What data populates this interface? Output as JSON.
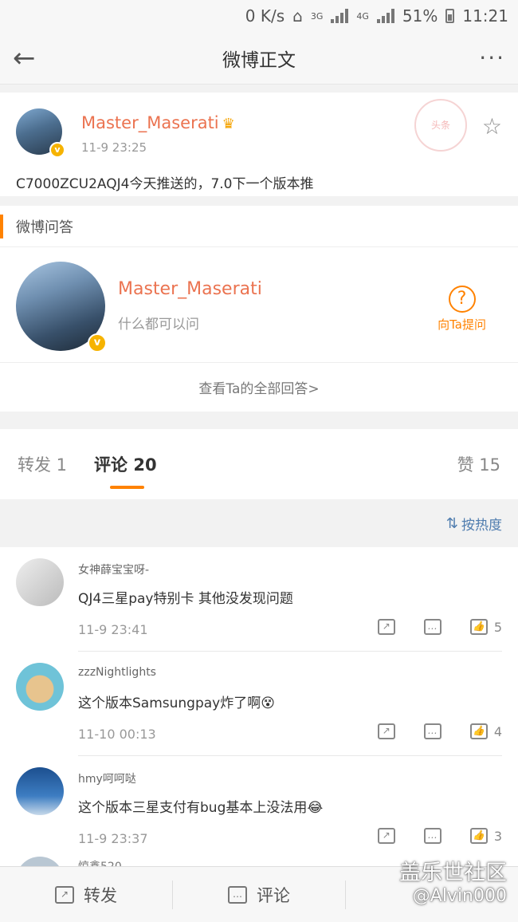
{
  "status_bar": {
    "speed": "0 K/s",
    "net1": "3G",
    "net2": "4G",
    "battery": "51%",
    "time": "11:21"
  },
  "nav": {
    "back_icon": "back-arrow-icon",
    "title": "微博正文",
    "more_icon": "more-dots-icon"
  },
  "post": {
    "author": "Master_Maserati",
    "time": "11-9 23:25",
    "text": "C7000ZCU2AQJ4今天推送的，7.0下一个版本推",
    "stamp": "头条"
  },
  "qa": {
    "header": "微博问答",
    "name": "Master_Maserati",
    "subtitle": "什么都可以问",
    "ask_label": "向Ta提问",
    "view_all": "查看Ta的全部回答>"
  },
  "tabs": {
    "repost": "转发 1",
    "comment": "评论 20",
    "like": "赞 15"
  },
  "sort": {
    "label": "按热度"
  },
  "comments": [
    {
      "name": "女神薛宝宝呀-",
      "text": "QJ4三星pay特别卡 其他没发现问题",
      "time": "11-9 23:41",
      "likes": "5"
    },
    {
      "name": "zzzNightlights",
      "text": "这个版本Samsungpay炸了啊😵",
      "time": "11-10 00:13",
      "likes": "4"
    },
    {
      "name": "hmy呵呵哒",
      "text": "这个版本三星支付有bug基本上没法用😂",
      "time": "11-9 23:37",
      "likes": "3"
    }
  ],
  "peek_name": "惊鑫520",
  "bottom": {
    "repost": "转发",
    "comment": "评论"
  },
  "watermark": {
    "line1": "盖乐世社区",
    "line2": "@Alvin000"
  },
  "colors": {
    "accent": "#ff8200",
    "name": "#eb7350",
    "link": "#507daf"
  }
}
